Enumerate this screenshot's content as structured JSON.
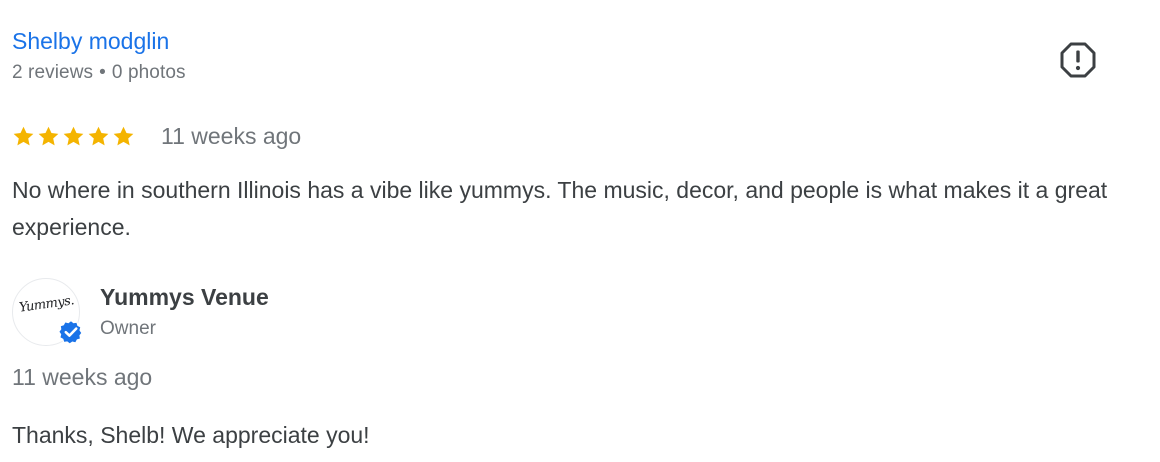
{
  "review": {
    "reviewer_name": "Shelby modglin",
    "reviews_count": "2 reviews",
    "separator": "•",
    "photos_count": "0 photos",
    "flag_icon": "report-flag-icon",
    "rating": 5,
    "rating_max": 5,
    "star_color": "#f4b400",
    "date": "11 weeks ago",
    "text": "No where in southern Illinois has a vibe like yummys. The music, decor, and people is what makes it a great experience."
  },
  "owner_response": {
    "avatar_text": "Yummys.",
    "verified_icon": "verified-check-icon",
    "owner_name": "Yummys Venue",
    "role": "Owner",
    "date": "11 weeks ago",
    "text": "Thanks, Shelb! We appreciate you!"
  },
  "colors": {
    "link": "#1a73e8",
    "secondary_text": "#70757a",
    "primary_text": "#3c4043",
    "verified_blue": "#1a73e8"
  }
}
